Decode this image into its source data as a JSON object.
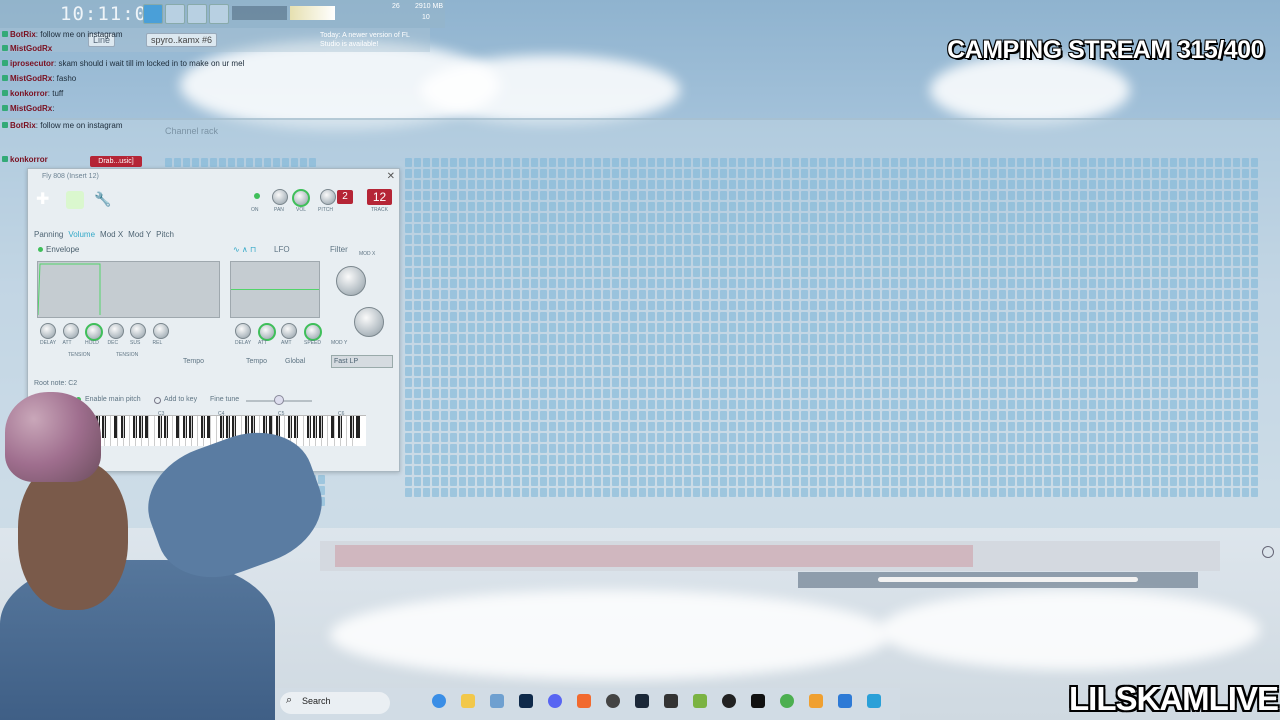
{
  "toolbar": {
    "clock": "10:11:00",
    "cpu": "26",
    "mem": "2910 MB",
    "voices": "10",
    "pattern_mode": "Line",
    "pattern_name": "spyro..kamx #6",
    "notice": "Today: A newer version of FL Studio is available!"
  },
  "chat": {
    "messages": [
      {
        "user": "BotRix",
        "text": ": follow me on instagram"
      },
      {
        "user": "MistGodRx",
        "text": ""
      },
      {
        "user": "iprosecutor",
        "text": ": skam should i wait till im locked in to make on ur mel"
      },
      {
        "user": "MistGodRx",
        "text": ": fasho"
      },
      {
        "user": "konkorror",
        "text": ": tuff"
      },
      {
        "user": "MistGodRx",
        "text": ":"
      },
      {
        "user": "BotRix",
        "text": ": follow me on instagram"
      },
      {
        "user": "konkorror",
        "text": ""
      }
    ]
  },
  "overlay": {
    "title": "CAMPING STREAM 315/400",
    "brand": "LILSKAMLIVE"
  },
  "channel_rack": {
    "title": "Channel rack",
    "selected_channel": "Drab...usic]"
  },
  "plugin": {
    "title": "Fly 808 (Insert 12)",
    "tabs": [
      "Panning",
      "Volume",
      "Mod X",
      "Mod Y",
      "Pitch"
    ],
    "active_tab": "Volume",
    "envelope_label": "Envelope",
    "lfo_label": "LFO",
    "filter_label": "Filter",
    "mod_x_label": "MOD X",
    "mod_y_label": "MOD Y",
    "filter_type": "Fast LP",
    "tempo_label": "Tempo",
    "global_label": "Global",
    "root_note_label": "Root note: C2",
    "enable_main_pitch": "Enable main pitch",
    "add_to_key": "Add to key",
    "fine_tune": "Fine tune",
    "pitch_value": "2",
    "track_value": "12",
    "track_label": "TRACK",
    "env_knobs": [
      "DELAY",
      "ATT",
      "HOLD",
      "DEC",
      "SUS",
      "REL"
    ],
    "tension_labels": [
      "TENSION",
      "TENSION"
    ],
    "lfo_knobs": [
      "DELAY",
      "ATT",
      "AMT",
      "SPEED"
    ],
    "header_knob_labels": [
      "ON",
      "PAN",
      "VOL",
      "PITCH"
    ],
    "octave_labels": [
      "C3",
      "C4",
      "C5",
      "C6"
    ]
  },
  "taskbar": {
    "search_placeholder": "Search"
  }
}
